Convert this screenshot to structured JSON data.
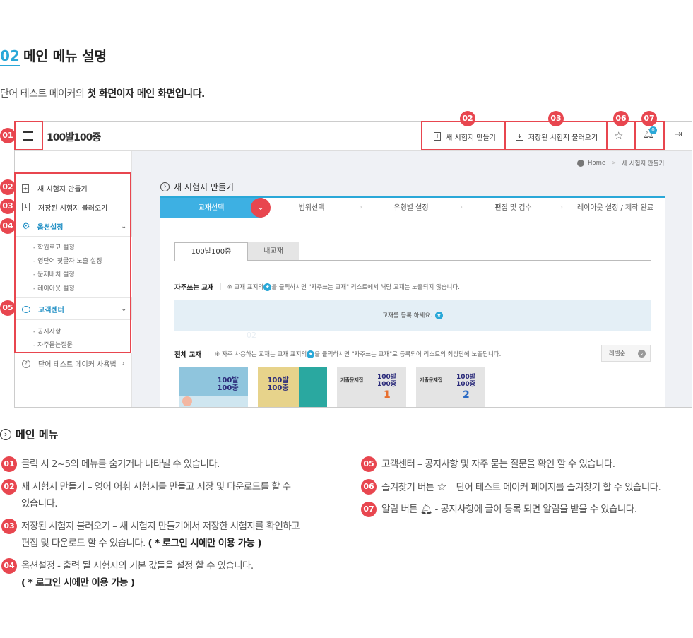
{
  "section": {
    "number": "02",
    "title": "메인 메뉴 설명"
  },
  "intro": {
    "text": "단어 테스트 메이커의 ",
    "bold": "첫 화면이자 메인 화면입니다."
  },
  "app": {
    "logo": "100발100중",
    "toolbar": {
      "new_label": "새 시험지 만들기",
      "load_label": "저장된 시험지 불러오기",
      "notif_count": "0"
    },
    "breadcrumb": {
      "home": "Home",
      "current": "새 시험지 만들기"
    },
    "sidebar": {
      "new": "새 시험지 만들기",
      "load": "저장된 시험지 불러오기",
      "options": "옵션설정",
      "option_items": [
        "- 학원로고 설정",
        "- 영단어 첫글자 노출 설정",
        "- 문제배치 설정",
        "- 레이아웃 설정"
      ],
      "support": "고객센터",
      "support_items": [
        "- 공지사항",
        "- 자주묻는질문"
      ],
      "howto": "단어 테스트 메이커 사용법"
    },
    "main": {
      "title": "새 시험지 만들기",
      "steps": [
        "교재선택",
        "범위선택",
        "유형별 설정",
        "편집 및 검수",
        "레이아웃 설정 / 제작 완료"
      ],
      "tabs": [
        "100발100중",
        "내교재"
      ],
      "freq_title": "자주쓰는 교재",
      "freq_note": "※ 교재 표지의 ",
      "freq_note2": " 을 클릭하시면 \"자주쓰는 교재\" 리스트에서 해당 교재는 노출되지 않습니다.",
      "register": "교재를 등록 하세요.",
      "all_title": "전체 교재",
      "all_note": "※ 자주 사용하는 교재는 교재 표지의 ",
      "all_note2": " 을 클릭하시면 \"자주쓰는 교재\"로 등록되어 리스트의 최상단에 노출됩니다.",
      "sort": "레벨순",
      "faded": "02",
      "books": [
        {
          "brand": "100발100중",
          "sub": ""
        },
        {
          "brand": "100발100중",
          "sub": ""
        },
        {
          "brand": "100발100중",
          "sub": "기출문제집",
          "num": "1"
        },
        {
          "brand": "100발100중",
          "sub": "기출문제집",
          "num": "2"
        }
      ]
    },
    "badges": [
      "01",
      "02",
      "03",
      "04",
      "05",
      "06",
      "07"
    ]
  },
  "menu": {
    "heading": "메인 메뉴",
    "items": [
      {
        "num": "01",
        "text": "클릭 시 2~5의 메뉴를 숨기거나 나타낼 수 있습니다."
      },
      {
        "num": "02",
        "text": "새 시험지 만들기 – 영어 어휘 시험지를 만들고 저장 및 다운로드를 할 수",
        "text2": "있습니다."
      },
      {
        "num": "03",
        "text": "저장된 시험지 불러오기 – 새 시험지 만들기에서 저장한 시험지를 확인하고",
        "text2": "편집 및 다운로드 할 수 있습니다. ",
        "bold": "( * 로그인 시에만 이용 가능 )"
      },
      {
        "num": "04",
        "text": "옵션설정 - 출력 될 시험지의 기본 값들을 설정 할 수 있습니다.",
        "bold": "( * 로그인 시에만 이용 가능 )"
      },
      {
        "num": "05",
        "text": "고객센터 – 공지사항 및 자주 묻는 질문을 확인 할 수 있습니다."
      },
      {
        "num": "06",
        "text": "즐겨찾기 버튼 ",
        "text2": " – 단어 테스트 메이커 페이지를 즐겨찾기 할 수 있습니다."
      },
      {
        "num": "07",
        "text": "알림 버튼 ",
        "text2": " - 공지사항에 글이 등록 되면 알림을 받을 수 있습니다."
      }
    ]
  }
}
